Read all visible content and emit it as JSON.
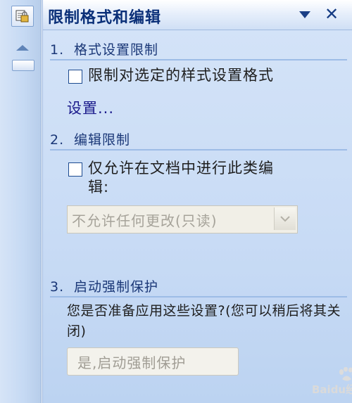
{
  "pane": {
    "title": "限制格式和编辑"
  },
  "sections": {
    "formatting": {
      "number": "1.",
      "title": "格式设置限制",
      "checkbox_label": "限制对选定的样式设置格式",
      "settings_link": "设置..."
    },
    "editing": {
      "number": "2.",
      "title": "编辑限制",
      "checkbox_label_line1": "仅允许在文档中进行此类编",
      "checkbox_label_line2": "辑:",
      "dropdown_value": "不允许任何更改(只读)"
    },
    "enforce": {
      "number": "3.",
      "title": "启动强制保护",
      "note": "您是否准备应用这些设置?(您可以稍后将其关闭)",
      "button_label": "是,启动强制保护"
    }
  },
  "watermark": {
    "text": "Baidu经验"
  },
  "icons": {
    "strip_button": "document-protect-icon",
    "dropdown": "chevron-down-icon",
    "close": "close-icon"
  }
}
